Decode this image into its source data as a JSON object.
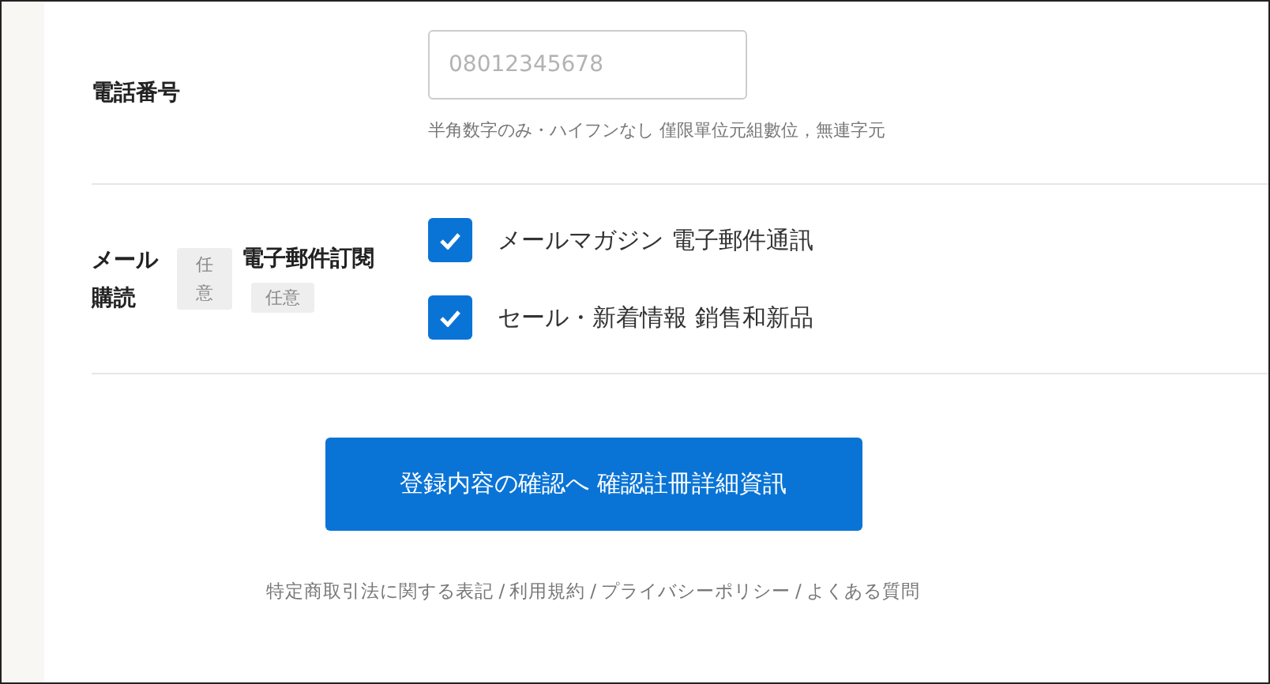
{
  "phone": {
    "label": "電話番号",
    "placeholder": "08012345678",
    "hint": "半角数字のみ・ハイフンなし 僅限單位元組數位，無連字元"
  },
  "mail": {
    "label_lines": [
      "メール",
      "購読"
    ],
    "badge": "任意",
    "label_zh": "電子郵件訂閱",
    "badge_zh": "任意",
    "options": [
      {
        "label": "メールマガジン 電子郵件通訊",
        "checked": true
      },
      {
        "label": "セール・新着情報 銷售和新品",
        "checked": true
      }
    ]
  },
  "submit": "登録内容の確認へ 確認註冊詳細資訊",
  "footer_separator": "/",
  "footer_links": [
    "特定商取引法に関する表記",
    "利用規約",
    "プライバシーポリシー",
    "よくある質問"
  ]
}
